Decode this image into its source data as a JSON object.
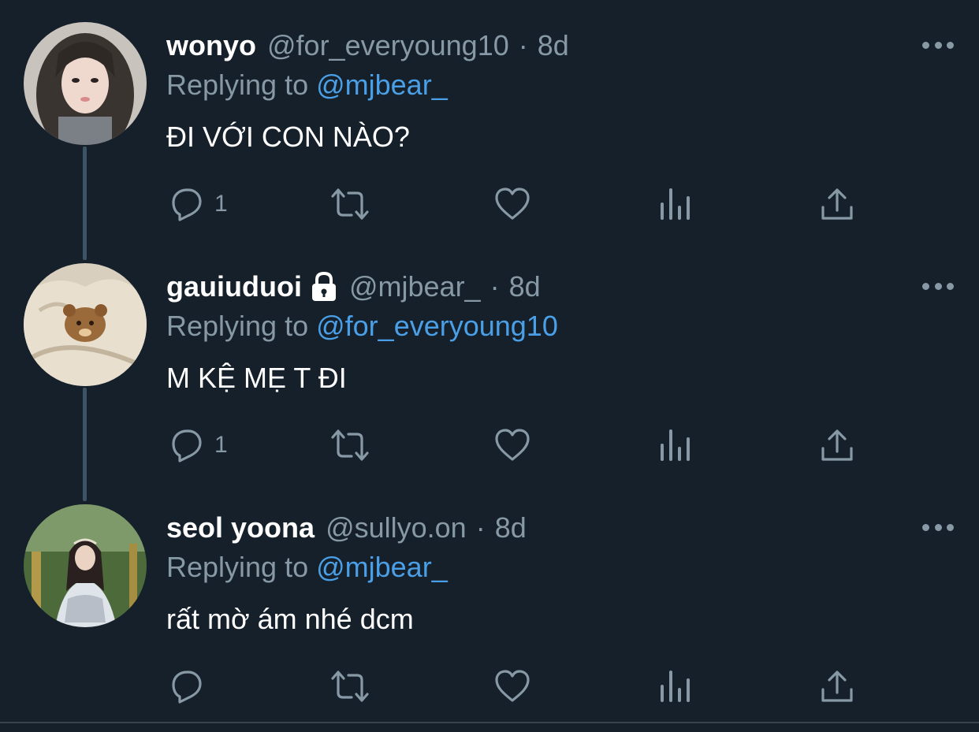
{
  "tweets": [
    {
      "name": "wonyo",
      "handle": "@for_everyoung10",
      "separator": "·",
      "time": "8d",
      "replying_prefix": "Replying to ",
      "replying_to": "@mjbear_",
      "text": "ĐI VỚI CON NÀO?",
      "reply_count": "1",
      "locked": false
    },
    {
      "name": "gauiuduoi",
      "handle": "@mjbear_",
      "separator": "·",
      "time": "8d",
      "replying_prefix": "Replying to ",
      "replying_to": "@for_everyoung10",
      "text": "M KỆ MẸ T ĐI",
      "reply_count": "1",
      "locked": true
    },
    {
      "name": "seol yoona",
      "handle": "@sullyo.on",
      "separator": "·",
      "time": "8d",
      "replying_prefix": "Replying to ",
      "replying_to": "@mjbear_",
      "text": "rất mờ ám nhé dcm",
      "reply_count": "",
      "locked": false
    }
  ],
  "icons": {
    "reply": "reply-icon",
    "retweet": "retweet-icon",
    "like": "heart-icon",
    "analytics": "analytics-icon",
    "share": "share-icon",
    "more": "more-icon",
    "lock": "lock-icon"
  },
  "colors": {
    "background": "#15202b",
    "secondary_text": "#8899a6",
    "mention": "#4a9fe6",
    "thread_line": "#3d5466"
  }
}
